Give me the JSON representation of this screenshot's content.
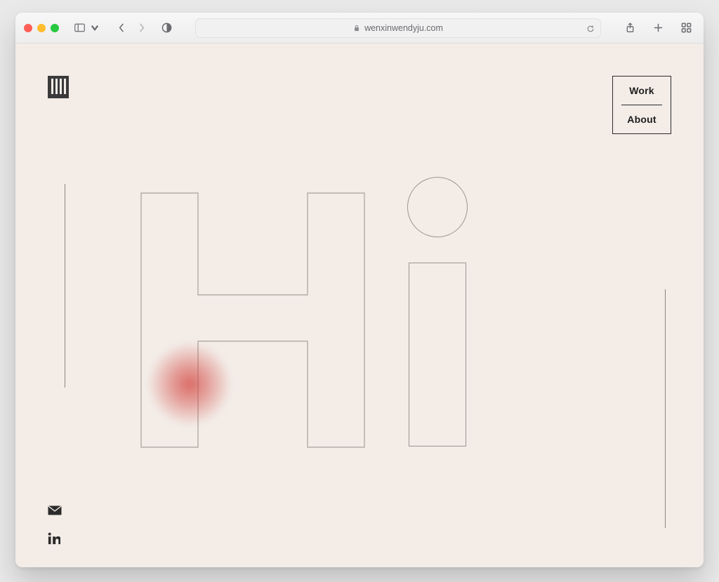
{
  "browser": {
    "url_display": "wenxinwendyju.com"
  },
  "nav": {
    "work": "Work",
    "about": "About"
  }
}
